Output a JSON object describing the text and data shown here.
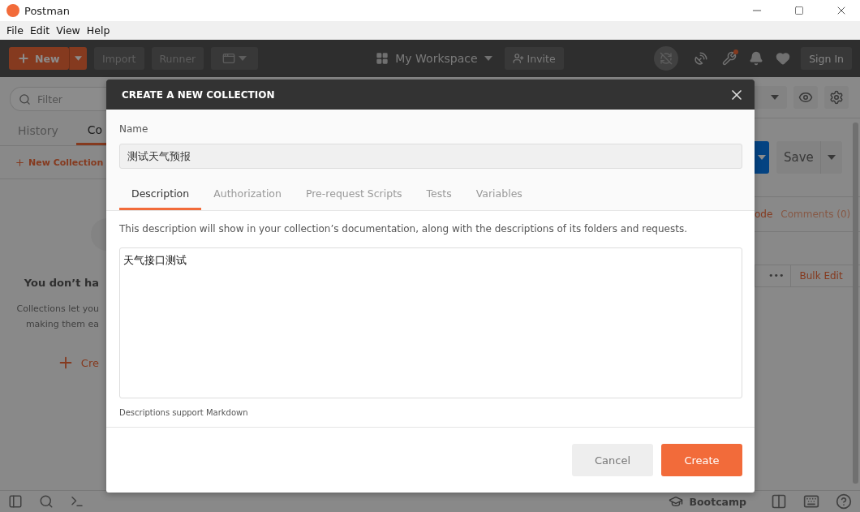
{
  "window": {
    "title": "Postman"
  },
  "menu": [
    "File",
    "Edit",
    "View",
    "Help"
  ],
  "header": {
    "new_button": "New",
    "buttons": [
      "Import",
      "Runner"
    ],
    "workspace": "My Workspace",
    "invite": "Invite",
    "sign_in": "Sign In"
  },
  "sidebar": {
    "filter_placeholder": "Filter",
    "tabs": [
      {
        "label": "History",
        "selected": false
      },
      {
        "label": "Co",
        "selected": true
      }
    ],
    "new_collection": "New Collection",
    "empty_title": "You don’t ha",
    "empty_lines": [
      "Collections let you",
      "making them ea"
    ],
    "create_link": "Cre"
  },
  "request": {
    "save": "Save",
    "links": [
      {
        "label": "ode",
        "selected": true
      },
      {
        "label": "Comments (0)",
        "selected": false
      }
    ],
    "more": "•••",
    "bulk_edit": "Bulk Edit"
  },
  "footer": {
    "bootcamp": "Bootcamp"
  },
  "dialog": {
    "title": "CREATE A NEW COLLECTION",
    "name_label": "Name",
    "name_value": "测试天气预报",
    "tabs": [
      {
        "label": "Description",
        "selected": true
      },
      {
        "label": "Authorization",
        "selected": false
      },
      {
        "label": "Pre-request Scripts",
        "selected": false
      },
      {
        "label": "Tests",
        "selected": false
      },
      {
        "label": "Variables",
        "selected": false
      }
    ],
    "hint": "This description will show in your collection’s documentation, along with the descriptions of its folders and requests.",
    "description": "天气接口测试",
    "footnote": "Descriptions support Markdown",
    "buttons": [
      {
        "label": "Cancel",
        "kind": "secondary"
      },
      {
        "label": "Create",
        "kind": "primary"
      }
    ]
  }
}
